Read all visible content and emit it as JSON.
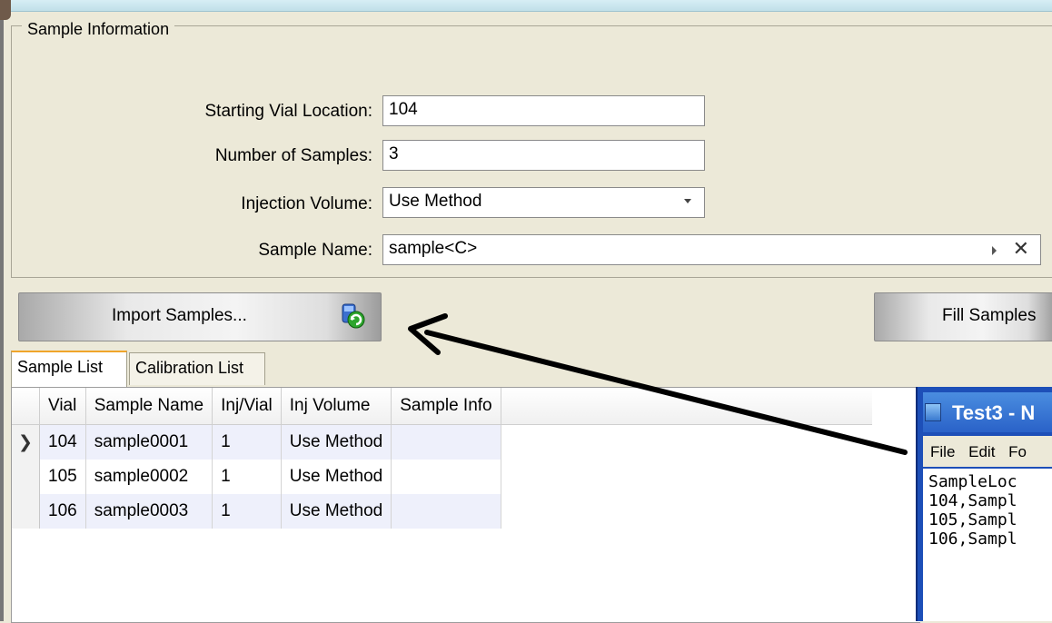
{
  "group": {
    "title": "Sample Information"
  },
  "fields": {
    "starting_vial": {
      "label": "Starting Vial Location:",
      "value": "104"
    },
    "num_samples": {
      "label": "Number of Samples:",
      "value": "3"
    },
    "inj_volume": {
      "label": "Injection Volume:",
      "value": "Use Method"
    },
    "sample_name": {
      "label": "Sample Name:",
      "value": "sample<C>",
      "clear": "✕"
    }
  },
  "buttons": {
    "import": "Import Samples...",
    "fill": "Fill Samples"
  },
  "tabs": [
    {
      "label": "Sample List"
    },
    {
      "label": "Calibration List"
    }
  ],
  "table": {
    "columns": [
      "Vial",
      "Sample Name",
      "Inj/Vial",
      "Inj Volume",
      "Sample Info"
    ],
    "rows": [
      {
        "marker": "❯",
        "vial": "104",
        "name": "sample0001",
        "inj": "1",
        "vol": "Use Method",
        "info": ""
      },
      {
        "marker": "",
        "vial": "105",
        "name": "sample0002",
        "inj": "1",
        "vol": "Use Method",
        "info": ""
      },
      {
        "marker": "",
        "vial": "106",
        "name": "sample0003",
        "inj": "1",
        "vol": "Use Method",
        "info": ""
      }
    ]
  },
  "notepad": {
    "title": "Test3 - N",
    "menu": [
      "File",
      "Edit",
      "Fo"
    ],
    "lines": [
      "SampleLoc",
      "104,Sampl",
      "105,Sampl",
      "106,Sampl"
    ]
  }
}
